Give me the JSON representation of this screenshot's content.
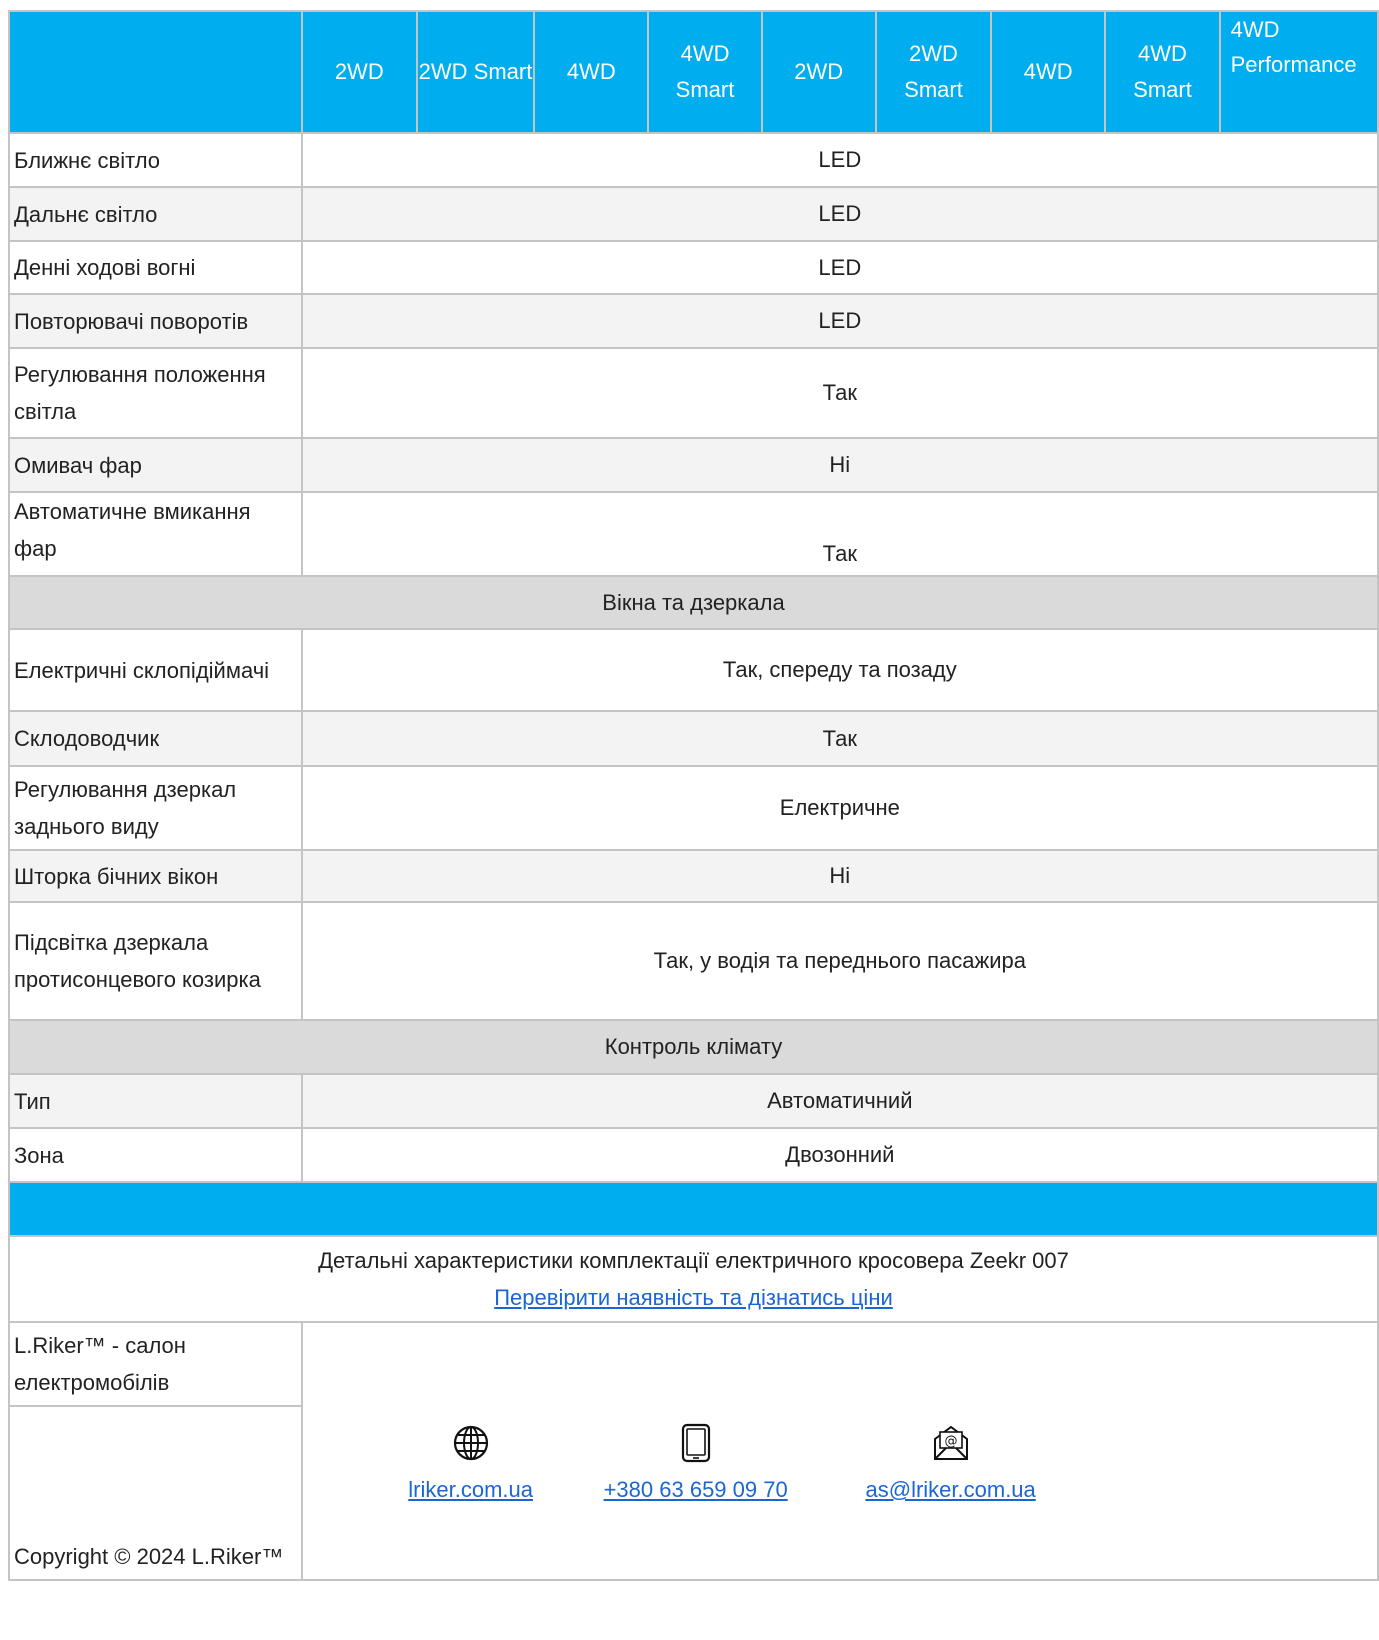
{
  "header": {
    "columns": [
      "2WD",
      "2WD Smart",
      "4WD",
      "4WD Smart",
      "2WD",
      "2WD Smart",
      "4WD",
      "4WD Smart",
      "4WD Performance"
    ]
  },
  "lighting": [
    {
      "label": "Ближнє світло",
      "value": "LED"
    },
    {
      "label": "Дальнє світло",
      "value": "LED"
    },
    {
      "label": "Денні ходові вогні",
      "value": "LED"
    },
    {
      "label": "Повторювачі поворотів",
      "value": "LED"
    },
    {
      "label": "Регулювання положення світла",
      "value": "Так"
    },
    {
      "label": "Омивач фар",
      "value": "Ні"
    },
    {
      "label": "Автоматичне вмикання фар",
      "value": "Так"
    }
  ],
  "section_windows": "Вікна та дзеркала",
  "windows": [
    {
      "label": "Електричні склопідіймачі",
      "value": "Так, спереду та позаду"
    },
    {
      "label": "Склодоводчик",
      "value": "Так"
    },
    {
      "label": "Регулювання дзеркал заднього виду",
      "value": "Електричне"
    },
    {
      "label": "Шторка бічних вікон",
      "value": "Ні"
    },
    {
      "label": "Підсвітка дзеркала протисонцевого козирка",
      "value": "Так, у водія та переднього пасажира"
    }
  ],
  "section_climate": "Контроль клімату",
  "climate": [
    {
      "label": "Тип",
      "value": "Автоматичний"
    },
    {
      "label": "Зона",
      "value": "Двозонний"
    }
  ],
  "info": {
    "description": "Детальні характеристики комплектації електричного кросовера Zeekr 007",
    "link": "Перевірити наявність та дізнатись ціни"
  },
  "footer": {
    "company": "L.Riker™ - салон електромобілів",
    "copyright": "Copyright © 2024 L.Riker™",
    "contacts": [
      {
        "icon": "globe-icon",
        "text": "lriker.com.ua"
      },
      {
        "icon": "tablet-icon",
        "text": "+380 63 659 09 70"
      },
      {
        "icon": "envelope-at-icon",
        "text": "as@lriker.com.ua"
      }
    ]
  }
}
